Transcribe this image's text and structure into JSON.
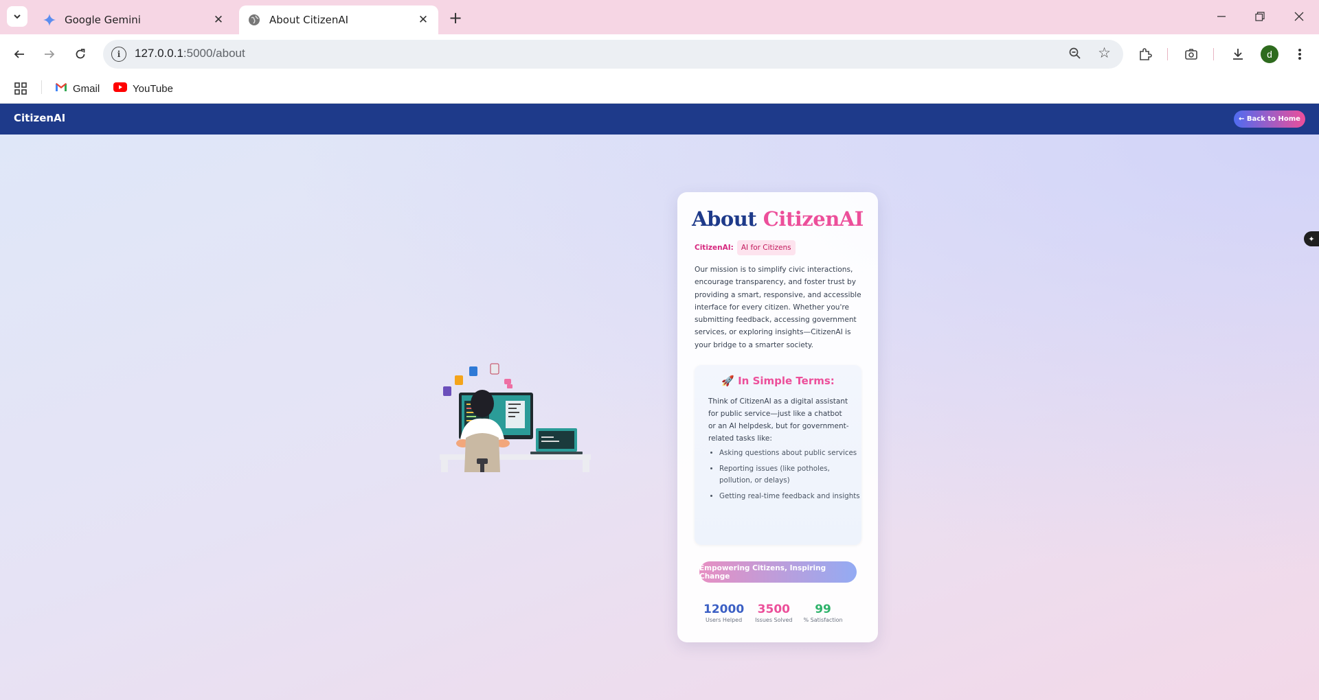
{
  "browser": {
    "tabs": [
      {
        "title": "Google Gemini",
        "icon": "gemini-icon",
        "active": false
      },
      {
        "title": "About CitizenAI",
        "icon": "globe-icon",
        "active": true
      }
    ],
    "url_host": "127.0.0.1",
    "url_path": ":5000/about",
    "profile_initial": "d",
    "bookmarks": [
      {
        "label": "Gmail",
        "icon": "gmail-icon"
      },
      {
        "label": "YouTube",
        "icon": "youtube-icon"
      }
    ]
  },
  "nav": {
    "brand": "CitizenAI",
    "back_label": "← Back to Home"
  },
  "about": {
    "title_part1": "About ",
    "title_part2": "CitizenAI",
    "tag_label": "CitizenAI:",
    "tag_chip": "AI for Citizens",
    "mission": "Our mission is to simplify civic interactions, encourage transparency, and foster trust by providing a smart, responsive, and accessible interface for every citizen. Whether you're submitting feedback, accessing government services, or exploring insights—CitizenAI is your bridge to a smarter society.",
    "simple_heading": "🚀 In Simple Terms:",
    "simple_body": "Think of CitizenAI as a digital assistant for public service—just like a chatbot or an AI helpdesk, but for government-related tasks like:",
    "simple_items": [
      "Asking questions about public services",
      "Reporting issues (like potholes, pollution, or delays)",
      "Getting real-time feedback and insights"
    ],
    "cta": "Empowering Citizens, Inspiring Change",
    "stats": [
      {
        "value": "12000",
        "label": "Users Helped",
        "color": "#3b5fc4"
      },
      {
        "value": "3500",
        "label": "Issues Solved",
        "color": "#ec4f9a"
      },
      {
        "value": "99",
        "label": "% Satisfaction",
        "color": "#2fb36b"
      }
    ]
  },
  "colors": {
    "nav_bg": "#1e3a8a",
    "accent_pink": "#ec4f9a",
    "brand_blue": "#1e3a8a"
  }
}
